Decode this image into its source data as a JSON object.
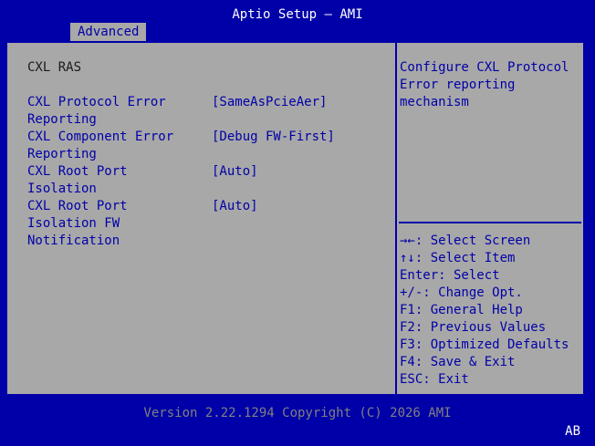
{
  "header": {
    "title": "Aptio Setup – AMI"
  },
  "tabs": [
    {
      "label": "Advanced"
    }
  ],
  "main": {
    "section": "CXL RAS",
    "items": [
      {
        "label_lines": [
          "CXL Protocol Error",
          "Reporting"
        ],
        "value": "[SameAsPcieAer]"
      },
      {
        "label_lines": [
          "CXL Component Error",
          "Reporting"
        ],
        "value": "[Debug FW-First]"
      },
      {
        "label_lines": [
          "CXL Root Port",
          "Isolation"
        ],
        "value": "[Auto]"
      },
      {
        "label_lines": [
          "CXL Root Port",
          "Isolation FW",
          "Notification"
        ],
        "value": "[Auto]"
      }
    ]
  },
  "help": {
    "lines": [
      "Configure CXL Protocol",
      "Error reporting",
      "mechanism"
    ]
  },
  "keys": [
    "→←: Select Screen",
    "↑↓: Select Item",
    "Enter: Select",
    "+/-: Change Opt.",
    "F1: General Help",
    "F2: Previous Values",
    "F3: Optimized Defaults",
    "F4: Save & Exit",
    "ESC: Exit"
  ],
  "footer": {
    "version": "Version 2.22.1294 Copyright (C) 2026 AMI",
    "badge": "AB"
  }
}
